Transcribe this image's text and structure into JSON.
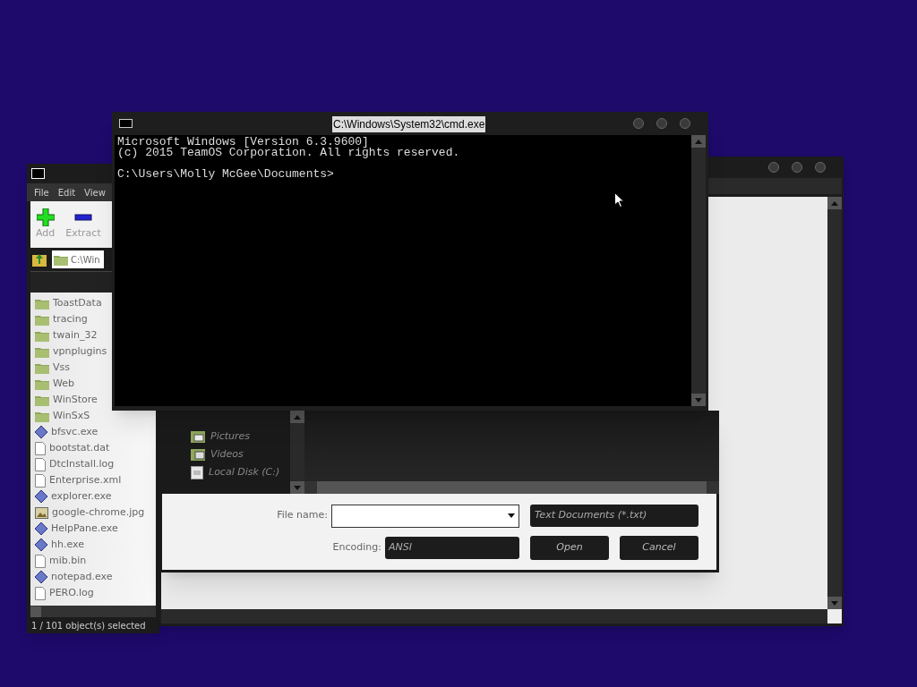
{
  "archive_window": {
    "menu": [
      "File",
      "Edit",
      "View"
    ],
    "toolbar": [
      {
        "label": "Add",
        "kind": "add"
      },
      {
        "label": "Extract",
        "kind": "extract"
      }
    ],
    "path": "C:\\Win",
    "files": [
      {
        "name": "ToastData",
        "kind": "folder"
      },
      {
        "name": "tracing",
        "kind": "folder"
      },
      {
        "name": "twain_32",
        "kind": "folder"
      },
      {
        "name": "vpnplugins",
        "kind": "folder"
      },
      {
        "name": "Vss",
        "kind": "folder"
      },
      {
        "name": "Web",
        "kind": "folder"
      },
      {
        "name": "WinStore",
        "kind": "folder"
      },
      {
        "name": "WinSxS",
        "kind": "folder"
      },
      {
        "name": "bfsvc.exe",
        "kind": "exe"
      },
      {
        "name": "bootstat.dat",
        "kind": "file"
      },
      {
        "name": "DtcInstall.log",
        "kind": "file"
      },
      {
        "name": "Enterprise.xml",
        "kind": "file"
      },
      {
        "name": "explorer.exe",
        "kind": "exe"
      },
      {
        "name": "google-chrome.jpg",
        "kind": "image"
      },
      {
        "name": "HelpPane.exe",
        "kind": "exe"
      },
      {
        "name": "hh.exe",
        "kind": "exe"
      },
      {
        "name": "mib.bin",
        "kind": "file"
      },
      {
        "name": "notepad.exe",
        "kind": "exe"
      },
      {
        "name": "PERO.log",
        "kind": "file"
      }
    ],
    "status": "1 / 101 object(s) selected"
  },
  "open_dialog": {
    "nav_items": [
      {
        "label": "Pictures",
        "kind": "pictures"
      },
      {
        "label": "Videos",
        "kind": "videos"
      },
      {
        "label": "Local Disk (C:)",
        "kind": "disk"
      }
    ],
    "file_name_label": "File name:",
    "file_type": "Text Documents (*.txt)",
    "encoding_label": "Encoding:",
    "encoding": "ANSI",
    "buttons": [
      "Open",
      "Cancel"
    ]
  },
  "cmd_window": {
    "title": "C:\\Windows\\System32\\cmd.exe",
    "lines": [
      {
        "text": "Microsoft Windows [Version 6.3.9600]",
        "kind": "output"
      },
      {
        "text": "(c) 2015 TeamOS Corporation. All rights reserved.",
        "kind": "output"
      },
      {
        "text": "C:\\Users\\Molly McGee\\Documents>",
        "kind": "prompt"
      }
    ]
  }
}
